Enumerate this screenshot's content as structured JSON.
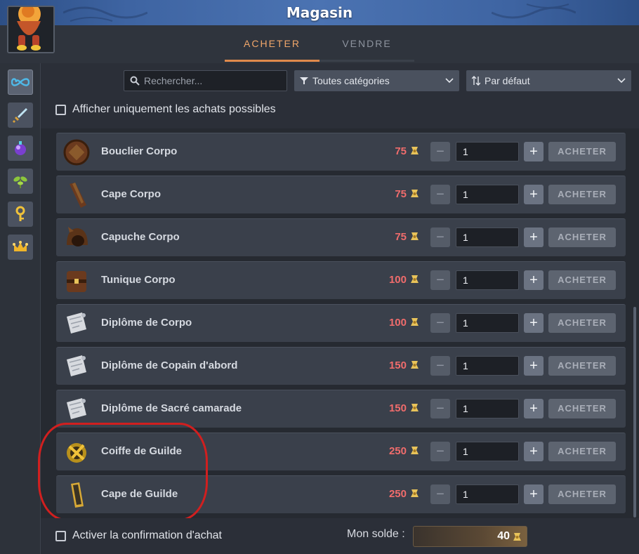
{
  "window": {
    "title": "Magasin"
  },
  "tabs": [
    {
      "label": "ACHETER",
      "active": true
    },
    {
      "label": "VENDRE",
      "active": false
    }
  ],
  "categories": [
    {
      "icon": "infinity-icon"
    },
    {
      "icon": "sword-icon"
    },
    {
      "icon": "potion-icon"
    },
    {
      "icon": "plant-icon"
    },
    {
      "icon": "key-icon"
    },
    {
      "icon": "crown-icon"
    }
  ],
  "filters": {
    "search_placeholder": "Rechercher...",
    "category": "Toutes catégories",
    "sort": "Par défaut",
    "affordable_only_label": "Afficher uniquement les achats possibles"
  },
  "items": [
    {
      "name": "Bouclier Corpo",
      "price": "75",
      "quantity": "1",
      "buy_label": "ACHETER",
      "icon": "shield-icon"
    },
    {
      "name": "Cape Corpo",
      "price": "75",
      "quantity": "1",
      "buy_label": "ACHETER",
      "icon": "cape-icon"
    },
    {
      "name": "Capuche Corpo",
      "price": "75",
      "quantity": "1",
      "buy_label": "ACHETER",
      "icon": "hood-icon"
    },
    {
      "name": "Tunique Corpo",
      "price": "100",
      "quantity": "1",
      "buy_label": "ACHETER",
      "icon": "tunic-icon"
    },
    {
      "name": "Diplôme de Corpo",
      "price": "100",
      "quantity": "1",
      "buy_label": "ACHETER",
      "icon": "diploma-icon"
    },
    {
      "name": "Diplôme de Copain d'abord",
      "price": "150",
      "quantity": "1",
      "buy_label": "ACHETER",
      "icon": "diploma-icon"
    },
    {
      "name": "Diplôme de Sacré camarade",
      "price": "150",
      "quantity": "1",
      "buy_label": "ACHETER",
      "icon": "diploma-icon"
    },
    {
      "name": "Coiffe de Guilde",
      "price": "250",
      "quantity": "1",
      "buy_label": "ACHETER",
      "icon": "guild-hat-icon"
    },
    {
      "name": "Cape de Guilde",
      "price": "250",
      "quantity": "1",
      "buy_label": "ACHETER",
      "icon": "guild-cape-icon"
    }
  ],
  "footer": {
    "confirm_label": "Activer la confirmation d'achat",
    "balance_label": "Mon solde :",
    "balance_value": "40"
  },
  "colors": {
    "price_unaffordable": "#f06c6c",
    "active_tab": "#f0a66a",
    "highlight": "#d11f1f"
  }
}
